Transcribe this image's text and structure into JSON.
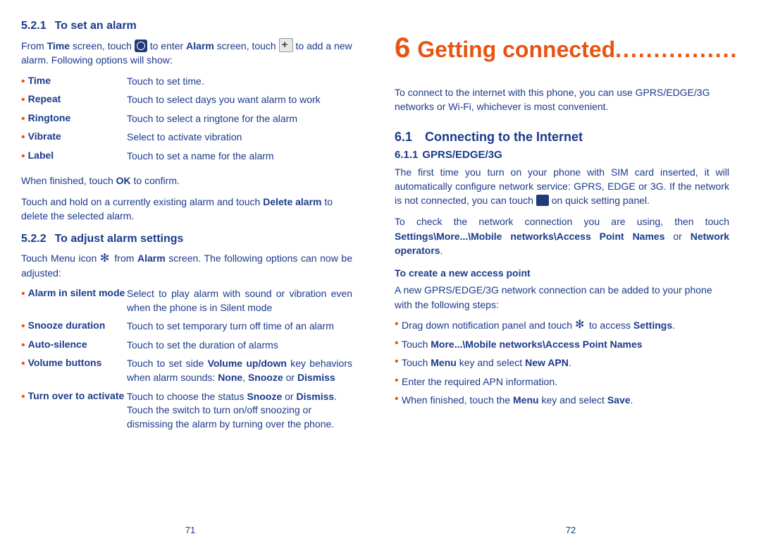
{
  "left": {
    "h521_num": "5.2.1",
    "h521_title": "To set an alarm",
    "p1_a": "From ",
    "p1_b": "Time",
    "p1_c": " screen, touch ",
    "p1_d": " to enter ",
    "p1_e": "Alarm",
    "p1_f": " screen, touch ",
    "p1_g": " to add a new alarm. Following options will show:",
    "opts1": [
      {
        "label": "Time",
        "desc": "Touch to set time."
      },
      {
        "label": "Repeat",
        "desc": "Touch to select days you want alarm to work"
      },
      {
        "label": "Ringtone",
        "desc": "Touch to select a ringtone for the alarm"
      },
      {
        "label": "Vibrate",
        "desc": "Select to activate vibration"
      },
      {
        "label": "Label",
        "desc": "Touch to set a name for the alarm"
      }
    ],
    "p2_a": "When finished, touch ",
    "p2_b": "OK",
    "p2_c": " to confirm.",
    "p3_a": "Touch and hold on a currently existing alarm and touch ",
    "p3_b": "Delete alarm",
    "p3_c": " to delete the selected alarm.",
    "h522_num": "5.2.2",
    "h522_title": "To adjust alarm settings",
    "p4_a": "Touch Menu icon ",
    "p4_b": " from ",
    "p4_c": "Alarm",
    "p4_d": " screen. The following options can now be adjusted:",
    "opts2": [
      {
        "label": "Alarm in silent mode",
        "desc": "Select to play alarm with sound or vibration even when the phone is in Silent mode"
      },
      {
        "label": "Snooze duration",
        "desc": "Touch to set temporary turn off time of an alarm"
      },
      {
        "label": "Auto-silence",
        "desc": "Touch to set the duration of alarms"
      }
    ],
    "opt_vol_label": "Volume buttons",
    "opt_vol_a": "Touch to set side ",
    "opt_vol_b": "Volume up/down",
    "opt_vol_c": " key behaviors when alarm sounds: ",
    "opt_vol_d": "None",
    "opt_vol_e": ", ",
    "opt_vol_f": "Snooze",
    "opt_vol_g": " or ",
    "opt_vol_h": "Dismiss",
    "opt_turn_label": "Turn over to activate",
    "opt_turn_a": "Touch to choose the status ",
    "opt_turn_b": "Snooze",
    "opt_turn_c": " or ",
    "opt_turn_d": "Dismiss",
    "opt_turn_e": ". Touch the switch to turn on/off snoozing or dismissing the alarm by turning over the phone.",
    "page_num": "71"
  },
  "right": {
    "chapter_num": "6",
    "chapter_title": "Getting connected",
    "chapter_dots": "................",
    "p1": "To connect to the internet with this phone, you can use GPRS/EDGE/3G networks or Wi-Fi, whichever is most convenient.",
    "h61_num": "6.1",
    "h61_title": "Connecting to the Internet",
    "h611_num": "6.1.1",
    "h611_title": "GPRS/EDGE/3G",
    "p2_a": "The first time you turn on your phone with SIM card inserted, it will automatically configure network service: GPRS, EDGE or 3G. If the network is not connected, you can touch ",
    "p2_b": " on quick setting panel.",
    "p3_a": "To check the network connection you are using, then touch ",
    "p3_b": "Settings\\More...\\Mobile networks\\Access Point Names",
    "p3_c": " or ",
    "p3_d": "Network operators",
    "p3_e": ".",
    "sub1": "To create a new access point",
    "p4": "A new GPRS/EDGE/3G network connection can be added to your phone with the following steps:",
    "b1_a": "Drag down notification panel and touch ",
    "b1_b": " to access ",
    "b1_c": "Settings",
    "b1_d": ".",
    "b2_a": "Touch ",
    "b2_b": "More...\\Mobile networks\\Access Point Names",
    "b3_a": "Touch ",
    "b3_b": "Menu",
    "b3_c": " key and select ",
    "b3_d": "New APN",
    "b3_e": ".",
    "b4": "Enter the required APN information.",
    "b5_a": "When finished, touch the ",
    "b5_b": "Menu",
    "b5_c": " key and select ",
    "b5_d": "Save",
    "b5_e": ".",
    "page_num": "72"
  }
}
